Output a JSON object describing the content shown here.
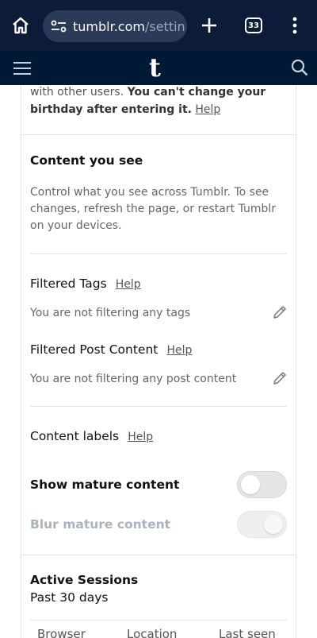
{
  "browser": {
    "url_host": "tumblr.com",
    "url_path": "/settin",
    "tab_count": "33"
  },
  "birthday": {
    "text_plain": "with other users. ",
    "text_bold": "You can't change your birthday after entering it.",
    "help": "Help"
  },
  "content_you_see": {
    "heading": "Content you see",
    "description": "Control what you see across Tumblr. To see changes, refresh the page, or restart Tumblr on your devices."
  },
  "filtered_tags": {
    "label": "Filtered Tags",
    "help": "Help",
    "status": "You are not filtering any tags"
  },
  "filtered_post_content": {
    "label": "Filtered Post Content",
    "help": "Help",
    "status": "You are not filtering any post content"
  },
  "content_labels": {
    "label": "Content labels",
    "help": "Help",
    "show_mature": {
      "label": "Show mature content",
      "on": false
    },
    "blur_mature": {
      "label": "Blur mature content",
      "on": true,
      "disabled": true
    }
  },
  "active_sessions": {
    "heading": "Active Sessions",
    "subheading": "Past 30 days",
    "columns": [
      "Browser",
      "Location",
      "Last seen"
    ]
  },
  "colors": {
    "browser_chrome": "#0b1b38",
    "tumblr_nav": "#001935",
    "text_muted": "#666666",
    "disabled_text": "#a8b3bb"
  }
}
